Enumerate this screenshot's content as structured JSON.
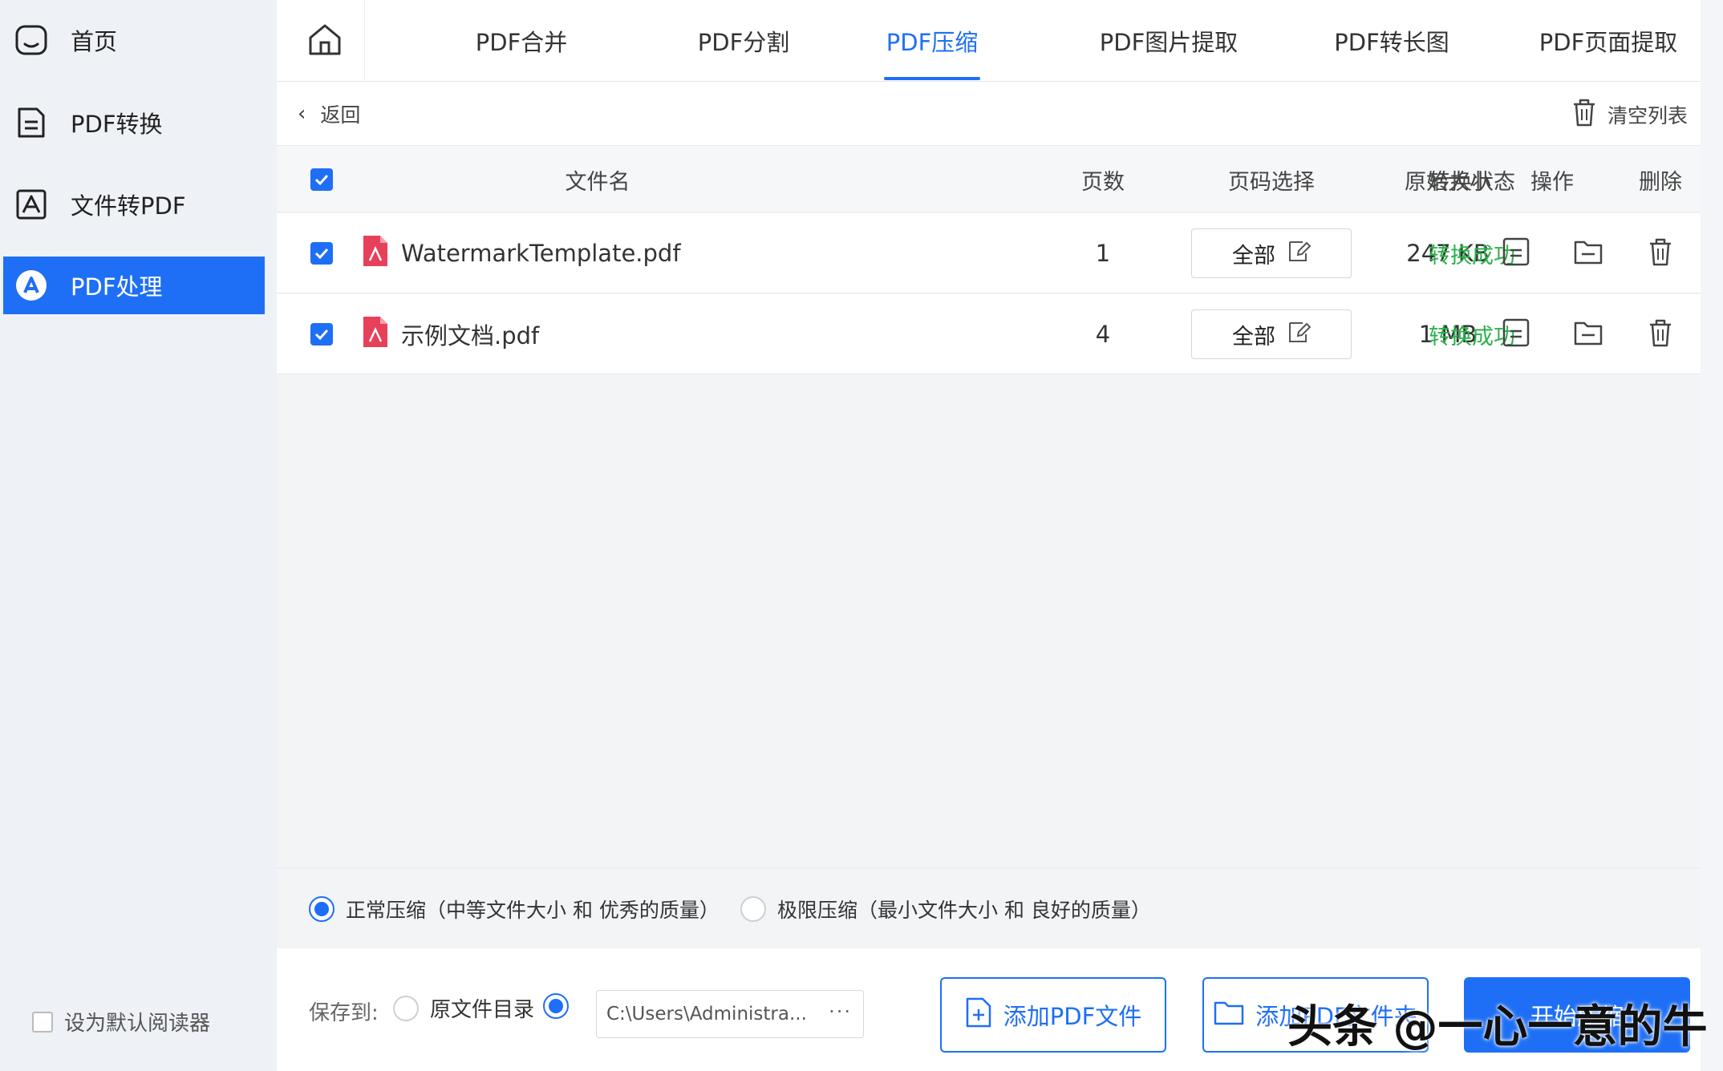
{
  "sidebar": {
    "items": [
      {
        "label": "首页",
        "icon": "home-icon"
      },
      {
        "label": "PDF转换",
        "icon": "document-convert-icon"
      },
      {
        "label": "文件转PDF",
        "icon": "image-to-pdf-icon"
      },
      {
        "label": "PDF处理",
        "icon": "pdf-tools-icon",
        "active": true
      }
    ],
    "default_reader_label": "设为默认阅读器",
    "default_reader_checked": false
  },
  "tabs": [
    {
      "label": "PDF合并"
    },
    {
      "label": "PDF分割"
    },
    {
      "label": "PDF压缩",
      "active": true
    },
    {
      "label": "PDF图片提取"
    },
    {
      "label": "PDF转长图"
    },
    {
      "label": "PDF页面提取"
    }
  ],
  "toolbar": {
    "back_label": "返回",
    "clear_label": "清空列表"
  },
  "table": {
    "headers": {
      "filename": "文件名",
      "pages": "页数",
      "page_select": "页码选择",
      "original_size": "原始大小",
      "status": "转换状态",
      "actions": "操作",
      "delete": "删除"
    },
    "rows": [
      {
        "checked": true,
        "filename": "WatermarkTemplate.pdf",
        "pages": "1",
        "page_select": "全部",
        "original_size": "247 KB",
        "status": "转换成功"
      },
      {
        "checked": true,
        "filename": "示例文档.pdf",
        "pages": "4",
        "page_select": "全部",
        "original_size": "1 MB",
        "status": "转换成功"
      }
    ]
  },
  "compression": {
    "options": [
      {
        "label": "正常压缩（中等文件大小 和 优秀的质量）",
        "selected": true
      },
      {
        "label": "极限压缩（最小文件大小 和 良好的质量）",
        "selected": false
      }
    ]
  },
  "bottom": {
    "save_label": "保存到:",
    "original_dir_label": "原文件目录",
    "original_dir_selected": false,
    "custom_dir_selected": true,
    "path": "C:\\Users\\Administra...",
    "path_more": "···",
    "add_pdf_label": "添加PDF文件",
    "add_folder_label": "添加PDF文件夹",
    "start_label": "开始压缩"
  },
  "watermark": "头条 @一心一意的牛",
  "colors": {
    "accent": "#1e6ff5",
    "success": "#2bb24c"
  }
}
